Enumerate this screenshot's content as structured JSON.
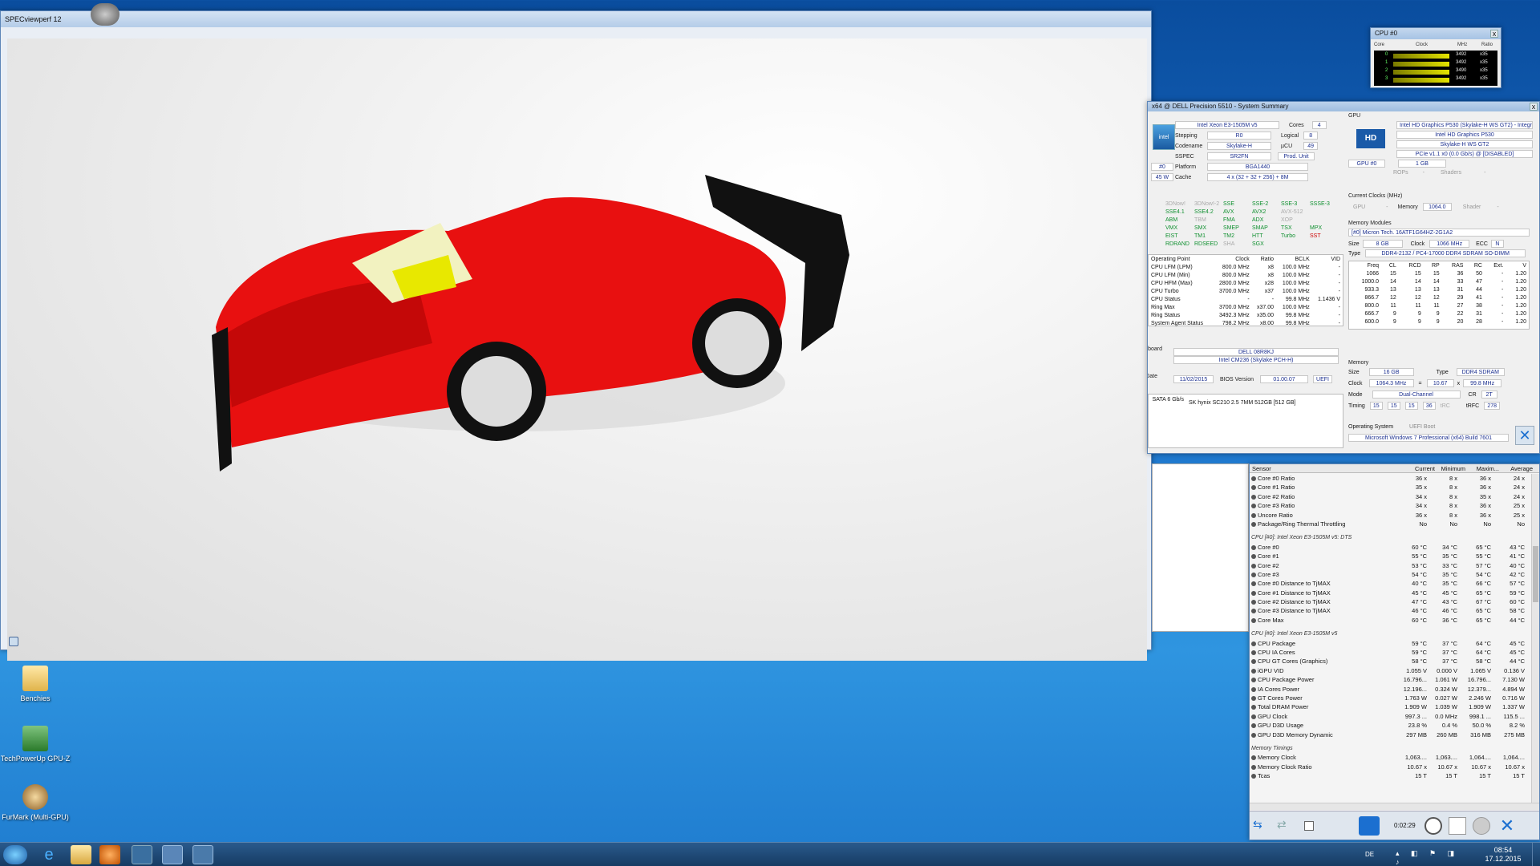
{
  "specviewperf": {
    "title": "SPECviewperf 12"
  },
  "cpuz_mini": {
    "title": "CPU #0",
    "close": "x",
    "headers": [
      "Core",
      "Clock",
      "MHz",
      "Ratio"
    ],
    "rows": [
      {
        "core": "0",
        "mhz": "3492",
        "ratio": "x35"
      },
      {
        "core": "1",
        "mhz": "3492",
        "ratio": "x35"
      },
      {
        "core": "2",
        "mhz": "3490",
        "ratio": "x35"
      },
      {
        "core": "3",
        "mhz": "3492",
        "ratio": "x35"
      }
    ]
  },
  "sysinfo": {
    "title": "x64 @ DELL Precision 5510 - System Summary",
    "close": "x",
    "cpu": {
      "name": "Intel Xeon E3-1505M v5",
      "cores_label": "Cores",
      "cores": "4",
      "stepping_label": "Stepping",
      "stepping": "R0",
      "logical_label": "Logical",
      "logical": "8",
      "codename_label": "Codename",
      "codename": "Skylake-H",
      "ucu_label": "µCU",
      "ucu": "49",
      "sspec_label": "SSPEC",
      "sspec": "SR2FN",
      "produnit": "Prod. Unit",
      "platform_label": "Platform",
      "platform": "BGA1440",
      "cache_label": "Cache",
      "cache": "4 x (32 + 32 + 256) + 8M",
      "sel": "#0",
      "tdp": "45 W"
    },
    "features": [
      {
        "t": "3DNow!",
        "s": "off"
      },
      {
        "t": "3DNow!-2",
        "s": "off"
      },
      {
        "t": "SSE",
        "s": "on"
      },
      {
        "t": "SSE-2",
        "s": "on"
      },
      {
        "t": "SSE-3",
        "s": "on"
      },
      {
        "t": "SSSE-3",
        "s": "on"
      },
      {
        "t": "SSE4.1",
        "s": "on"
      },
      {
        "t": "SSE4.2",
        "s": "on"
      },
      {
        "t": "AVX",
        "s": "on"
      },
      {
        "t": "AVX2",
        "s": "on"
      },
      {
        "t": "AVX-512",
        "s": "off"
      },
      {
        "t": "",
        "s": "off"
      },
      {
        "t": "ABM",
        "s": "on"
      },
      {
        "t": "TBM",
        "s": "off"
      },
      {
        "t": "FMA",
        "s": "on"
      },
      {
        "t": "ADX",
        "s": "on"
      },
      {
        "t": "XOP",
        "s": "off"
      },
      {
        "t": "",
        "s": "off"
      },
      {
        "t": "VMX",
        "s": "on"
      },
      {
        "t": "SMX",
        "s": "on"
      },
      {
        "t": "SMEP",
        "s": "on"
      },
      {
        "t": "SMAP",
        "s": "on"
      },
      {
        "t": "TSX",
        "s": "on"
      },
      {
        "t": "MPX",
        "s": "on"
      },
      {
        "t": "EIST",
        "s": "on"
      },
      {
        "t": "TM1",
        "s": "on"
      },
      {
        "t": "TM2",
        "s": "on"
      },
      {
        "t": "HTT",
        "s": "on"
      },
      {
        "t": "Turbo",
        "s": "on"
      },
      {
        "t": "SST",
        "s": "red"
      },
      {
        "t": "RDRAND",
        "s": "on"
      },
      {
        "t": "RDSEED",
        "s": "on"
      },
      {
        "t": "SHA",
        "s": "off"
      },
      {
        "t": "SGX",
        "s": "on"
      },
      {
        "t": "",
        "s": "off"
      },
      {
        "t": "",
        "s": "off"
      }
    ],
    "op_headers": [
      "Operating Point",
      "Clock",
      "Ratio",
      "BCLK",
      "VID"
    ],
    "op_rows": [
      [
        "CPU LFM (LPM)",
        "800.0 MHz",
        "x8",
        "100.0 MHz",
        "-"
      ],
      [
        "CPU LFM (Min)",
        "800.0 MHz",
        "x8",
        "100.0 MHz",
        "-"
      ],
      [
        "CPU HFM (Max)",
        "2800.0 MHz",
        "x28",
        "100.0 MHz",
        "-"
      ],
      [
        "CPU Turbo",
        "3700.0 MHz",
        "x37",
        "100.0 MHz",
        "-"
      ],
      [
        "CPU Status",
        "-",
        "-",
        "99.8 MHz",
        "1.1436 V"
      ],
      [
        "Ring Max",
        "3700.0 MHz",
        "x37.00",
        "100.0 MHz",
        "-"
      ],
      [
        "Ring Status",
        "3492.3 MHz",
        "x35.00",
        "99.8 MHz",
        "-"
      ],
      [
        "System Agent Status",
        "798.2 MHz",
        "x8.00",
        "99.8 MHz",
        "-"
      ]
    ],
    "mb": {
      "label": "Motherboard",
      "name": "DELL 08R8KJ",
      "chipset": "Intel CM236 (Skylake PCH-H)",
      "bios_date_label": "BIOS Date",
      "bios_date": "11/02/2015",
      "bios_ver_label": "BIOS Version",
      "bios_ver": "01.00.07",
      "uefi": "UEFI"
    },
    "drive": {
      "iface": "SATA 6 Gb/s",
      "name": "SK hynix SC210 2.5 7MM 512GB [512 GB]"
    },
    "gpu": {
      "label": "GPU",
      "name": "Intel HD Graphics P530 (Skylake-H WS GT2) - Integr",
      "name2": "Intel HD Graphics P530",
      "codename": "Skylake-H WS GT2",
      "pcie": "PCIe v1.1 x0 (0.0 Gb/s) @ [DISABLED]",
      "sel": "GPU #0",
      "mem": "1 GB",
      "rops_label": "ROPs",
      "rops": "-",
      "shaders_label": "Shaders",
      "shaders": "-",
      "clk_label": "Current Clocks (MHz)",
      "gpu_label": "GPU",
      "gpu_clk": "-",
      "memory_label": "Memory",
      "memory_clk": "1064.0",
      "shader_label": "Shader",
      "shader_clk": "-"
    },
    "modules": {
      "label": "Memory Modules",
      "sel": "[#0] Micron Tech. 16ATF1G64HZ-2G1A2",
      "size_label": "Size",
      "size": "8 GB",
      "clock_label": "Clock",
      "clock": "1066 MHz",
      "ecc_label": "ECC",
      "ecc": "N",
      "type_label": "Type",
      "type": "DDR4-2132 / PC4-17000 DDR4 SDRAM SO-DIMM",
      "headers": [
        "Freq",
        "CL",
        "RCD",
        "RP",
        "RAS",
        "RC",
        "Ext.",
        "V"
      ],
      "rows": [
        [
          "1066",
          "15",
          "15",
          "15",
          "36",
          "50",
          "-",
          "1.20"
        ],
        [
          "1000.0",
          "14",
          "14",
          "14",
          "33",
          "47",
          "-",
          "1.20"
        ],
        [
          "933.3",
          "13",
          "13",
          "13",
          "31",
          "44",
          "-",
          "1.20"
        ],
        [
          "866.7",
          "12",
          "12",
          "12",
          "29",
          "41",
          "-",
          "1.20"
        ],
        [
          "800.0",
          "11",
          "11",
          "11",
          "27",
          "38",
          "-",
          "1.20"
        ],
        [
          "666.7",
          "9",
          "9",
          "9",
          "22",
          "31",
          "-",
          "1.20"
        ],
        [
          "600.0",
          "9",
          "9",
          "9",
          "20",
          "28",
          "-",
          "1.20"
        ]
      ]
    },
    "memory": {
      "label": "Memory",
      "size_label": "Size",
      "size": "16 GB",
      "type_label": "Type",
      "type": "DDR4 SDRAM",
      "clock_label": "Clock",
      "clock": "1064.3 MHz",
      "eq": "=",
      "mult": "10.67",
      "x": "x",
      "bclk": "99.8 MHz",
      "mode_label": "Mode",
      "mode": "Dual-Channel",
      "cr_label": "CR",
      "cr": "2T",
      "timing_label": "Timing",
      "t1": "15",
      "t2": "15",
      "t3": "15",
      "t4": "36",
      "trc": "tRC",
      "trfc_label": "tRFC",
      "trfc": "278"
    },
    "os": {
      "label": "Operating System",
      "boot": "UEFI Boot",
      "name": "Microsoft Windows 7 Professional (x64) Build 7601"
    }
  },
  "hwinfo": {
    "headers": [
      "Sensor",
      "Current",
      "Minimum",
      "Maxim...",
      "Average"
    ],
    "groups": [
      {
        "name": "",
        "rows": [
          [
            "Core #0 Ratio",
            "36 x",
            "8 x",
            "36 x",
            "24 x"
          ],
          [
            "Core #1 Ratio",
            "35 x",
            "8 x",
            "36 x",
            "24 x"
          ],
          [
            "Core #2 Ratio",
            "34 x",
            "8 x",
            "35 x",
            "24 x"
          ],
          [
            "Core #3 Ratio",
            "34 x",
            "8 x",
            "36 x",
            "25 x"
          ],
          [
            "Uncore Ratio",
            "36 x",
            "8 x",
            "36 x",
            "25 x"
          ],
          [
            "Package/Ring Thermal Throttling",
            "No",
            "No",
            "No",
            "No"
          ]
        ]
      },
      {
        "name": "CPU [#0]: Intel Xeon E3-1505M v5: DTS",
        "rows": [
          [
            "Core #0",
            "60 °C",
            "34 °C",
            "65 °C",
            "43 °C"
          ],
          [
            "Core #1",
            "55 °C",
            "35 °C",
            "55 °C",
            "41 °C"
          ],
          [
            "Core #2",
            "53 °C",
            "33 °C",
            "57 °C",
            "40 °C"
          ],
          [
            "Core #3",
            "54 °C",
            "35 °C",
            "54 °C",
            "42 °C"
          ],
          [
            "Core #0 Distance to TjMAX",
            "40 °C",
            "35 °C",
            "66 °C",
            "57 °C"
          ],
          [
            "Core #1 Distance to TjMAX",
            "45 °C",
            "45 °C",
            "65 °C",
            "59 °C"
          ],
          [
            "Core #2 Distance to TjMAX",
            "47 °C",
            "43 °C",
            "67 °C",
            "60 °C"
          ],
          [
            "Core #3 Distance to TjMAX",
            "46 °C",
            "46 °C",
            "65 °C",
            "58 °C"
          ],
          [
            "Core Max",
            "60 °C",
            "36 °C",
            "65 °C",
            "44 °C"
          ]
        ]
      },
      {
        "name": "CPU [#0]: Intel Xeon E3-1505M v5",
        "rows": [
          [
            "CPU Package",
            "59 °C",
            "37 °C",
            "64 °C",
            "45 °C"
          ],
          [
            "CPU IA Cores",
            "59 °C",
            "37 °C",
            "64 °C",
            "45 °C"
          ],
          [
            "CPU GT Cores (Graphics)",
            "58 °C",
            "37 °C",
            "58 °C",
            "44 °C"
          ],
          [
            "iGPU VID",
            "1.055 V",
            "0.000 V",
            "1.065 V",
            "0.136 V"
          ],
          [
            "CPU Package Power",
            "16.796...",
            "1.061 W",
            "16.796...",
            "7.130 W"
          ],
          [
            "IA Cores Power",
            "12.196...",
            "0.324 W",
            "12.379...",
            "4.894 W"
          ],
          [
            "GT Cores Power",
            "1.763 W",
            "0.027 W",
            "2.246 W",
            "0.716 W"
          ],
          [
            "Total DRAM Power",
            "1.909 W",
            "1.039 W",
            "1.909 W",
            "1.337 W"
          ],
          [
            "GPU Clock",
            "997.3 ...",
            "0.0 MHz",
            "998.1 ...",
            "115.5 ..."
          ],
          [
            "GPU D3D Usage",
            "23.8 %",
            "0.4 %",
            "50.0 %",
            "8.2 %"
          ],
          [
            "GPU D3D Memory Dynamic",
            "297 MB",
            "260 MB",
            "316 MB",
            "275 MB"
          ]
        ]
      },
      {
        "name": "Memory Timings",
        "rows": [
          [
            "Memory Clock",
            "1,063....",
            "1,063....",
            "1,064....",
            "1,064...."
          ],
          [
            "Memory Clock Ratio",
            "10.67 x",
            "10.67 x",
            "10.67 x",
            "10.67 x"
          ],
          [
            "Tcas",
            "15 T",
            "15 T",
            "15 T",
            "15 T"
          ]
        ]
      }
    ],
    "elapsed": "0:02:29"
  },
  "desktop": {
    "icons": [
      {
        "label": "Benchies"
      },
      {
        "label": "TechPowerUp GPU-Z"
      },
      {
        "label": "FurMark (Multi-GPU)"
      }
    ]
  },
  "taskbar": {
    "time": "08:54",
    "date": "17.12.2015",
    "lang": "DE"
  }
}
